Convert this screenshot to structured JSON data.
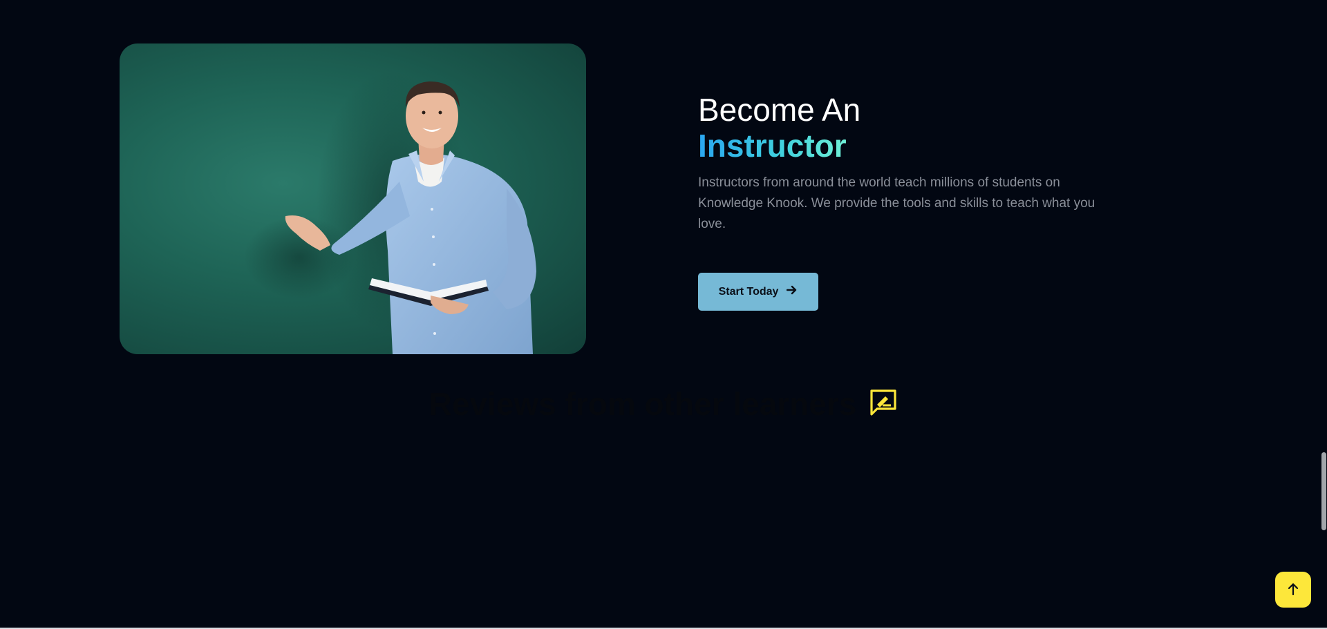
{
  "instructor_section": {
    "title_line1": "Become An",
    "title_line2": "Instructor",
    "description": "Instructors from around the world teach millions of students on Knowledge Knook. We provide the tools and skills to teach what you love.",
    "cta_label": "Start Today"
  },
  "reviews_section": {
    "title": "Reviews from other learners"
  },
  "icons": {
    "cta": "arrow-right-icon",
    "reviews": "review-edit-icon",
    "scroll_top": "arrow-up-icon"
  },
  "colors": {
    "background": "#020712",
    "accent_gradient_start": "#2aa6f0",
    "accent_gradient_end": "#6ff0d6",
    "cta_button": "#76b9d6",
    "scroll_top_button": "#fde73a",
    "review_icon": "#fde73a"
  }
}
